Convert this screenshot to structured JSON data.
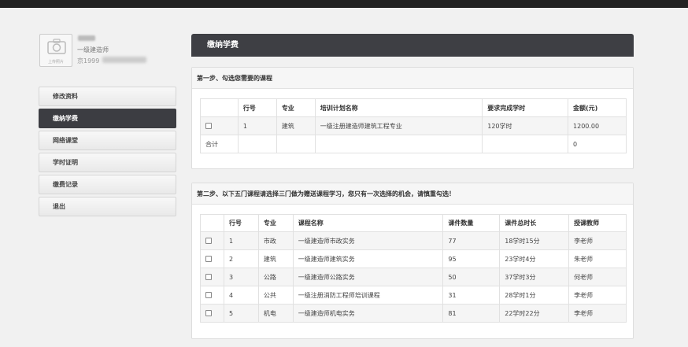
{
  "profile": {
    "avatar_caption": "上传照片",
    "role": "一级建造师",
    "phone_prefix": "京1999"
  },
  "menu": [
    {
      "label": "修改资料",
      "active": false
    },
    {
      "label": "缴纳学费",
      "active": true
    },
    {
      "label": "网络课堂",
      "active": false
    },
    {
      "label": "学时证明",
      "active": false
    },
    {
      "label": "缴费记录",
      "active": false
    },
    {
      "label": "退出",
      "active": false
    }
  ],
  "main": {
    "title": "缴纳学费"
  },
  "step1": {
    "heading": "第一步、勾选您需要的课程",
    "columns": [
      "",
      "行号",
      "专业",
      "培训计划名称",
      "要求完成学时",
      "金额(元)"
    ],
    "rows": [
      {
        "row": "1",
        "major": "建筑",
        "plan": "一级注册建造师建筑工程专业",
        "hours": "120学时",
        "amount": "1200.00"
      }
    ],
    "total_label": "合计",
    "total_amount": "0"
  },
  "step2": {
    "heading": "第二步、以下五门课程请选择三门做为赠送课程学习，您只有一次选择的机会，请慎重勾选！",
    "columns": [
      "",
      "行号",
      "专业",
      "课程名称",
      "课件数量",
      "课件总时长",
      "授课教师"
    ],
    "rows": [
      {
        "row": "1",
        "major": "市政",
        "course": "一级建造师市政实务",
        "count": "77",
        "duration": "18学时15分",
        "teacher": "李老师"
      },
      {
        "row": "2",
        "major": "建筑",
        "course": "一级建造师建筑实务",
        "count": "95",
        "duration": "23学时4分",
        "teacher": "朱老师"
      },
      {
        "row": "3",
        "major": "公路",
        "course": "一级建造师公路实务",
        "count": "50",
        "duration": "37学时3分",
        "teacher": "何老师"
      },
      {
        "row": "4",
        "major": "公共",
        "course": "一级注册消防工程师培训课程",
        "count": "31",
        "duration": "28学时1分",
        "teacher": "李老师"
      },
      {
        "row": "5",
        "major": "机电",
        "course": "一级建造师机电实务",
        "count": "81",
        "duration": "22学时22分",
        "teacher": "李老师"
      }
    ]
  }
}
